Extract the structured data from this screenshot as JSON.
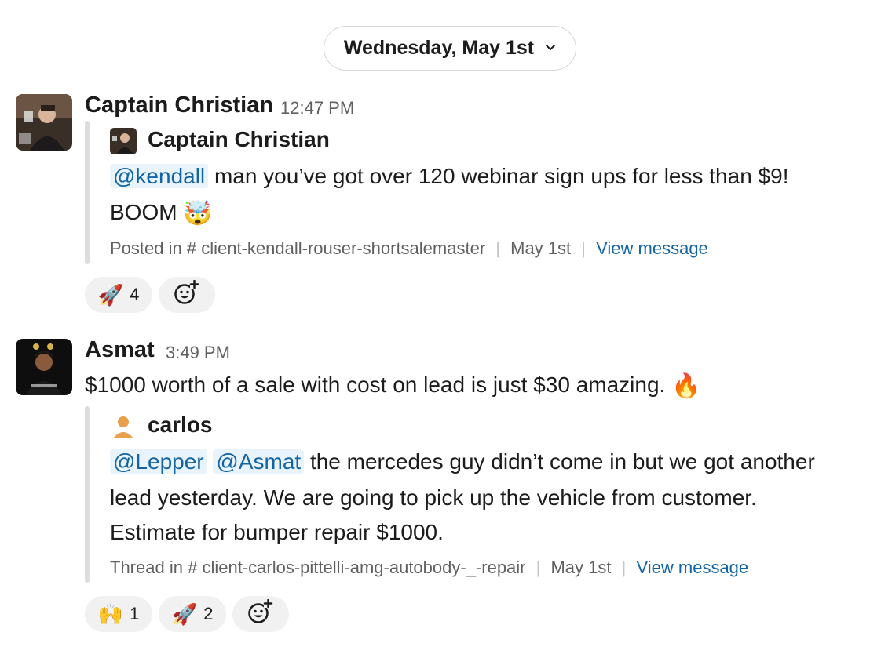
{
  "date_divider": {
    "label": "Wednesday, May 1st",
    "chevron_icon": "chevron-down-icon"
  },
  "messages": [
    {
      "sender": "Captain Christian",
      "time": "12:47 PM",
      "quote": {
        "author": "Captain Christian",
        "mentions": [
          "@kendall"
        ],
        "line1": "man you’ve got over 120 webinar sign ups for less than $9!",
        "line2": "BOOM",
        "line2_emoji": "🤯",
        "meta_prefix": "Posted in",
        "channel_icon": "hash-icon",
        "channel": "client-kendall-rouser-shortsalemaster",
        "date": "May 1st",
        "link": "View message"
      },
      "reactions": [
        {
          "emoji": "🚀",
          "count": "4"
        }
      ],
      "add_reaction_icon": "add-emoji-icon"
    },
    {
      "sender": "Asmat",
      "time": "3:49 PM",
      "text": "$1000 worth of a sale with cost on lead is just $30 amazing.",
      "text_emoji": "🔥",
      "quote": {
        "author": "carlos",
        "mentions": [
          "@Lepper",
          "@Asmat"
        ],
        "line1": "the mercedes guy didn’t come in but we got another",
        "line2": "lead yesterday. We are going to pick up the vehicle from customer.",
        "line3": "Estimate for bumper repair $1000.",
        "meta_prefix": "Thread in",
        "channel_icon": "hash-icon",
        "channel": "client-carlos-pittelli-amg-autobody-_-repair",
        "date": "May 1st",
        "link": "View message"
      },
      "reactions": [
        {
          "emoji": "🙌",
          "count": "1"
        },
        {
          "emoji": "🚀",
          "count": "2"
        }
      ],
      "add_reaction_icon": "add-emoji-icon"
    }
  ],
  "colors": {
    "link": "#1264a3",
    "mention_bg": "#e8f3fb",
    "muted_text": "#616061",
    "reaction_bg": "#f1f1f1",
    "quote_bar": "#dddddd"
  }
}
